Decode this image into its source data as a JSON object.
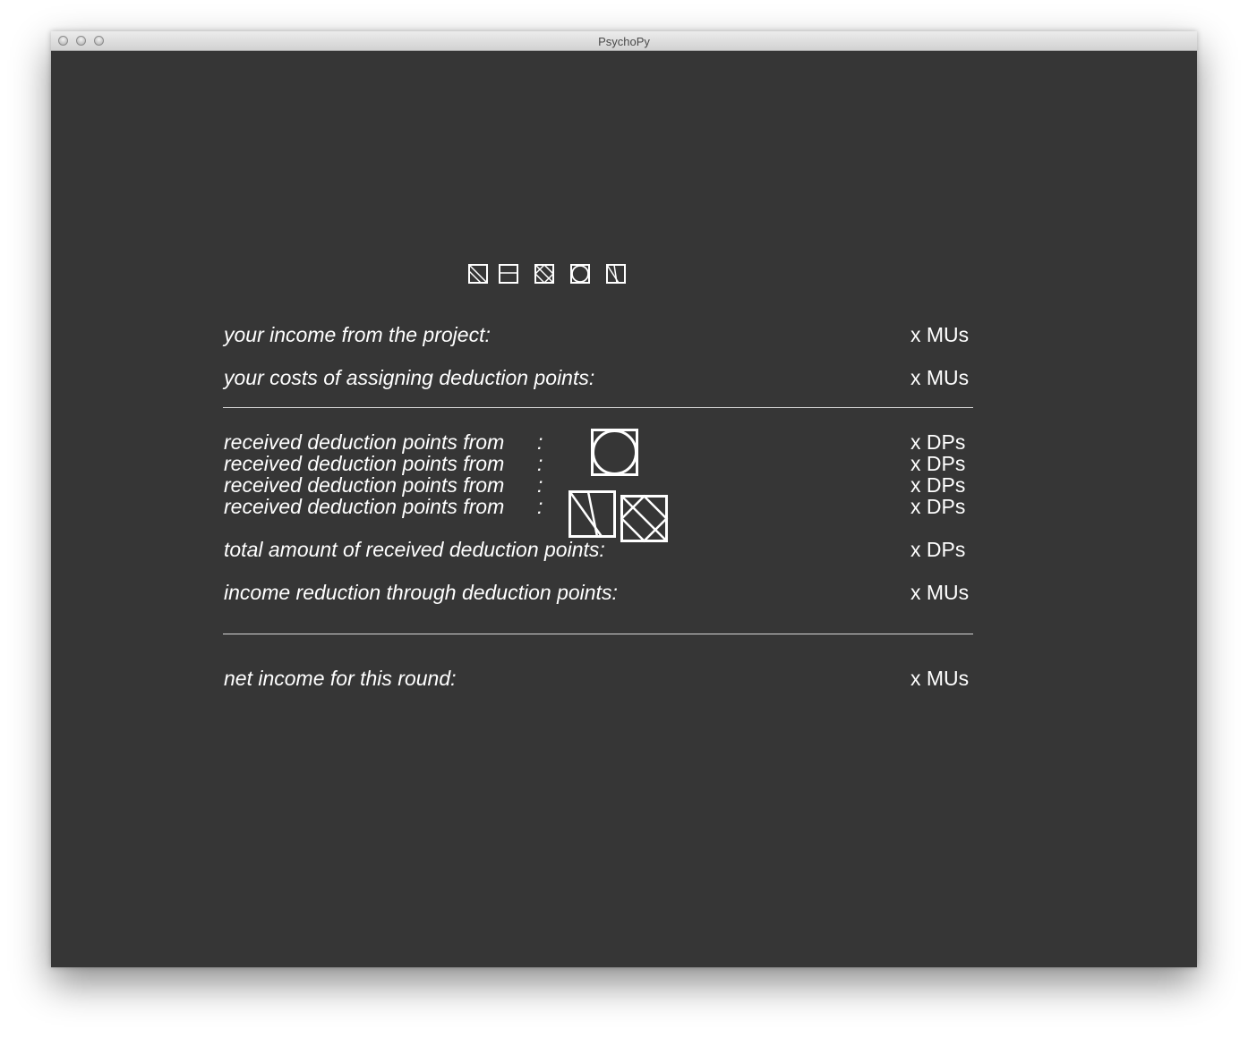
{
  "window": {
    "title": "PsychoPy"
  },
  "header_symbols": [
    "diagonal-corner-square-icon",
    "horizontal-split-square-icon",
    "hatched-diamond-square-icon",
    "circle-in-square-icon",
    "slanted-lines-square-icon"
  ],
  "rows": {
    "income_project": {
      "label": "your income from the project:",
      "value": "x MUs"
    },
    "costs_assigning": {
      "label": "your costs of assigning deduction points:",
      "value": "x MUs"
    },
    "received": [
      {
        "label": "received deduction points from",
        "colon": ":",
        "value": "x DPs"
      },
      {
        "label": "received deduction points from",
        "colon": ":",
        "value": "x DPs"
      },
      {
        "label": "received deduction points from",
        "colon": ":",
        "value": "x DPs"
      },
      {
        "label": "received deduction points from",
        "colon": ":",
        "value": "x DPs"
      }
    ],
    "total_received": {
      "label": "total amount of received deduction points:",
      "value": "x DPs"
    },
    "income_reduction": {
      "label": "income reduction through deduction points:",
      "value": "x MUs"
    },
    "net_income": {
      "label": "net income for this round:",
      "value": "x MUs"
    }
  },
  "large_symbols": [
    "circle-in-square-icon",
    "slanted-lines-square-icon",
    "hatched-diamond-square-icon"
  ],
  "colors": {
    "background": "#363636",
    "foreground": "#ffffff"
  }
}
